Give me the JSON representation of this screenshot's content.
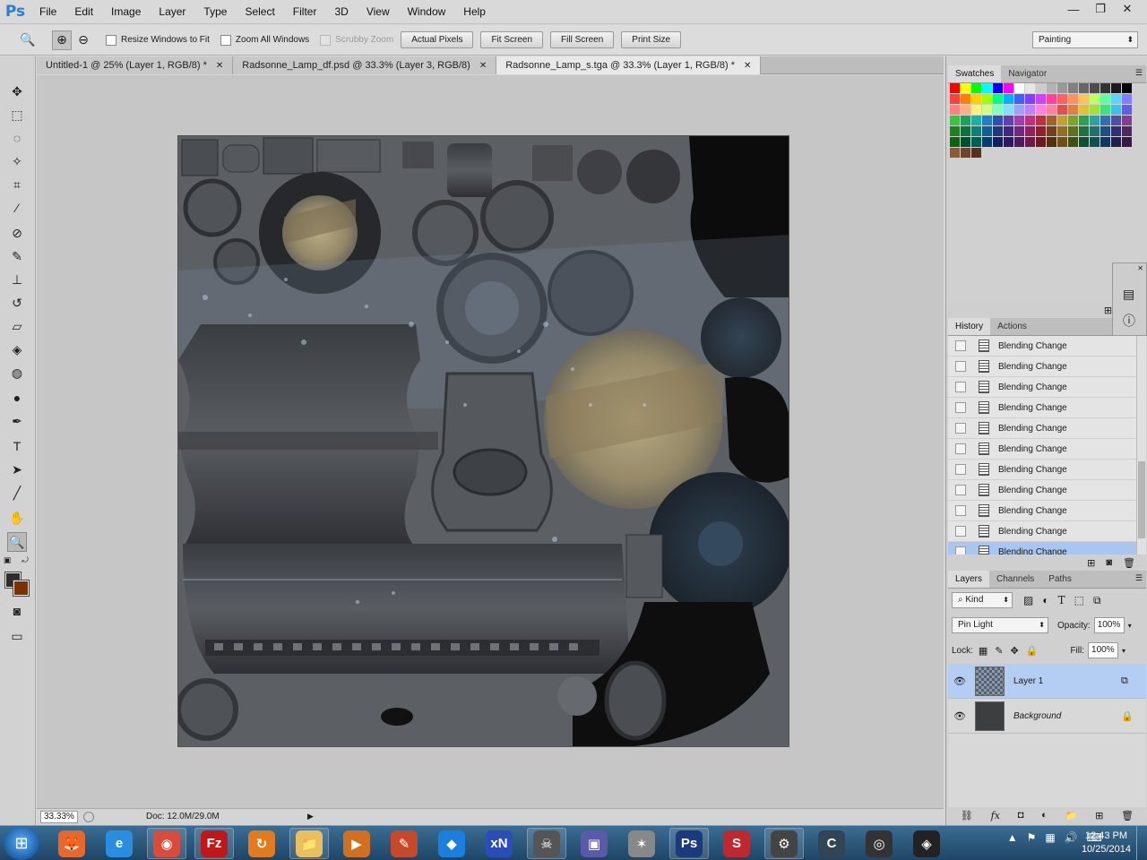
{
  "menubar": {
    "logo": "Ps",
    "items": [
      "File",
      "Edit",
      "Image",
      "Layer",
      "Type",
      "Select",
      "Filter",
      "3D",
      "View",
      "Window",
      "Help"
    ],
    "controls": [
      "—",
      "❐",
      "✕"
    ]
  },
  "options": {
    "checkboxes": [
      {
        "label": "Resize Windows to Fit",
        "disabled": false
      },
      {
        "label": "Zoom All Windows",
        "disabled": false
      },
      {
        "label": "Scrubby Zoom",
        "disabled": true
      }
    ],
    "buttons": [
      "Actual Pixels",
      "Fit Screen",
      "Fill Screen",
      "Print Size"
    ],
    "workspace": "Painting"
  },
  "tabs": [
    {
      "label": "Untitled-1 @ 25% (Layer 1, RGB/8) *",
      "active": false
    },
    {
      "label": "Radsonne_Lamp_df.psd @ 33.3% (Layer 3, RGB/8)",
      "active": false
    },
    {
      "label": "Radsonne_Lamp_s.tga @ 33.3% (Layer 1, RGB/8) *",
      "active": true
    }
  ],
  "status": {
    "zoom": "33.33%",
    "doc": "Doc: 12.0M/29.0M"
  },
  "swatches_panel": {
    "tabs": [
      "Swatches",
      "Navigator"
    ],
    "colors": [
      "#ff0000",
      "#ffff00",
      "#00ff00",
      "#00ffff",
      "#0000ff",
      "#ff00ff",
      "#ffffff",
      "#e6e6e6",
      "#cccccc",
      "#b3b3b3",
      "#999999",
      "#808080",
      "#666666",
      "#4d4d4d",
      "#333333",
      "#1a1a1a",
      "#000000",
      "#ff4040",
      "#ff8000",
      "#ffd000",
      "#a0ff00",
      "#00ff80",
      "#00b0ff",
      "#4060ff",
      "#8040ff",
      "#d040ff",
      "#ff40a0",
      "#ff6060",
      "#ff9060",
      "#ffc060",
      "#c0ff60",
      "#60ffa0",
      "#60d0ff",
      "#8080ff",
      "#ff8080",
      "#ffb080",
      "#fff080",
      "#d0ff80",
      "#80ffc0",
      "#80e0ff",
      "#a0a0ff",
      "#c080ff",
      "#ff80e0",
      "#ff80a0",
      "#e05050",
      "#e08040",
      "#e0c040",
      "#a0e040",
      "#40e080",
      "#40c0e0",
      "#6060e0",
      "#40c040",
      "#20a060",
      "#20b0a0",
      "#2080c0",
      "#3050b0",
      "#6040b0",
      "#a040b0",
      "#c03080",
      "#c03040",
      "#a06030",
      "#c0a030",
      "#80a030",
      "#30a050",
      "#30a0a0",
      "#3070b0",
      "#5050a0",
      "#804090",
      "#208020",
      "#107040",
      "#108070",
      "#106090",
      "#203880",
      "#402880",
      "#702880",
      "#902060",
      "#902030",
      "#704020",
      "#907020",
      "#607020",
      "#207040",
      "#207070",
      "#205080",
      "#303070",
      "#502860",
      "#106010",
      "#005030",
      "#006050",
      "#004070",
      "#102060",
      "#301860",
      "#501860",
      "#701848",
      "#701820",
      "#503010",
      "#705010",
      "#405010",
      "#105030",
      "#105050",
      "#103860",
      "#202050",
      "#381848",
      "#8a5a3a",
      "#6e4528",
      "#54321c"
    ]
  },
  "history_panel": {
    "tabs": [
      "History",
      "Actions"
    ],
    "items": [
      "Blending Change",
      "Blending Change",
      "Blending Change",
      "Blending Change",
      "Blending Change",
      "Blending Change",
      "Blending Change",
      "Blending Change",
      "Blending Change",
      "Blending Change",
      "Blending Change"
    ],
    "selected_index": 10
  },
  "layers_panel": {
    "tabs": [
      "Layers",
      "Channels",
      "Paths"
    ],
    "kind_label": "Kind",
    "blend_mode": "Pin Light",
    "opacity_label": "Opacity:",
    "opacity": "100%",
    "lock_label": "Lock:",
    "fill_label": "Fill:",
    "fill": "100%",
    "layers": [
      {
        "name": "Layer 1",
        "selected": true,
        "italic": false
      },
      {
        "name": "Background",
        "selected": false,
        "italic": true
      }
    ]
  },
  "taskbar": {
    "apps": [
      "firefox",
      "internet-explorer",
      "chrome",
      "filezilla",
      "app-orange",
      "explorer",
      "media-player",
      "app-paint",
      "dropbox",
      "app-xn",
      "app-skull",
      "app-folder",
      "zbrush",
      "photoshop",
      "substance",
      "app-gear",
      "app-c",
      "app-aperture",
      "app-wings"
    ],
    "app_glyphs": [
      "🦊",
      "e",
      "◉",
      "Fz",
      "↻",
      "📁",
      "▶",
      "✎",
      "◆",
      "xN",
      "☠",
      "▣",
      "✶",
      "Ps",
      "S",
      "⚙",
      "C",
      "◎",
      "◈"
    ],
    "clock_time": "12:43 PM",
    "clock_date": "10/25/2014"
  }
}
